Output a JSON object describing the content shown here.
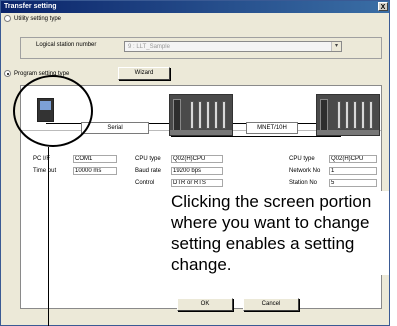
{
  "dialog": {
    "title": "Transfer setting",
    "close_glyph": "X"
  },
  "utility": {
    "radio_label": "Utility setting type",
    "logical_label": "Logical station number",
    "logical_value": "9 : LLT_Sample",
    "arrow": "▾"
  },
  "program": {
    "radio_label": "Program setting type",
    "wizard_label": "Wizard"
  },
  "diagram": {
    "serial_label": "Serial",
    "network_label": "MNET/10H"
  },
  "pc": {
    "if_label": "PC I/F",
    "if_value": "COM1",
    "timeout_label": "Time out",
    "timeout_value": "10000 ms"
  },
  "cpu1": {
    "type_label": "CPU type",
    "type_value": "Q02(H)CPU",
    "baud_label": "Baud rate",
    "baud_value": "19200 bps",
    "control_label": "Control",
    "control_value": "DTR or RTS"
  },
  "cpu2": {
    "type_label": "CPU type",
    "type_value": "Q02(H)CPU",
    "netno_label": "Network No",
    "netno_value": "1",
    "station_label": "Station No",
    "station_value": "5"
  },
  "note": "Clicking the screen portion where you want to change setting enables a setting change.",
  "buttons": {
    "ok": "OK",
    "cancel": "Cancel"
  }
}
